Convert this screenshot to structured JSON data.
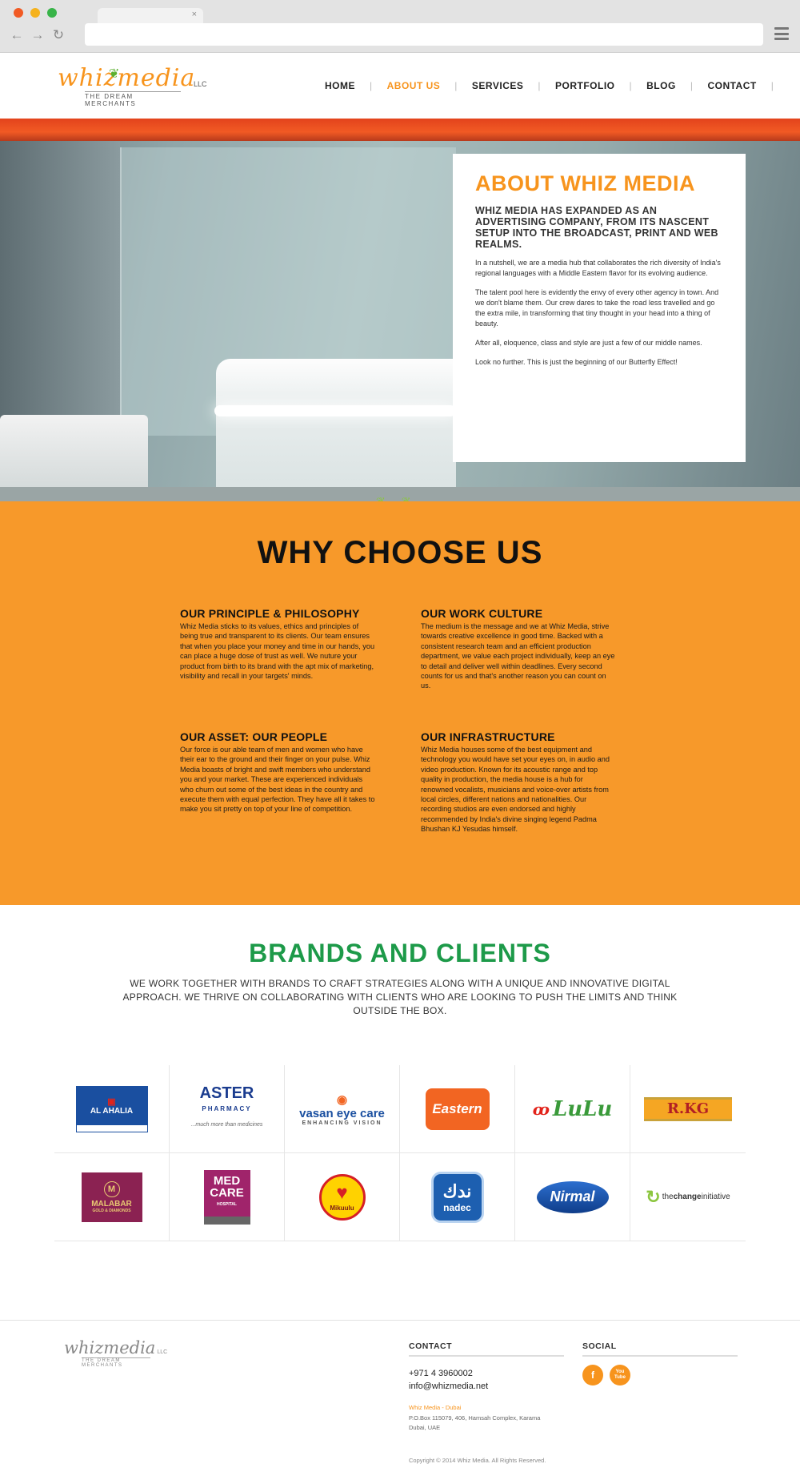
{
  "browser": {
    "tab_close": "×",
    "back_icon": "←",
    "forward_icon": "→",
    "reload_icon": "↻"
  },
  "header": {
    "logo_text": "whizmedia",
    "logo_llc": "LLC",
    "logo_tagline": "THE DREAM MERCHANTS",
    "nav": [
      {
        "label": "HOME"
      },
      {
        "label": "ABOUT US",
        "active": true
      },
      {
        "label": "SERVICES"
      },
      {
        "label": "PORTFOLIO"
      },
      {
        "label": "BLOG"
      },
      {
        "label": "CONTACT"
      }
    ]
  },
  "about": {
    "title": "ABOUT WHIZ MEDIA",
    "subtitle": "WHIZ MEDIA HAS EXPANDED AS AN ADVERTISING COMPANY, FROM ITS NASCENT SETUP INTO THE BROADCAST, PRINT AND WEB REALMS.",
    "paragraphs": [
      "In a nutshell, we are a media hub that collaborates the rich diversity of India's regional languages with a Middle Eastern flavor for its evolving audience.",
      "The talent pool here is evidently the envy of every other agency in town. And we don't blame them. Our crew dares to take the road less travelled and go the extra mile, in transforming that tiny thought in your head into a thing of beauty.",
      "After all, eloquence, class and style are just a few of our middle names.",
      "Look no further. This is just the beginning of our Butterfly Effect!"
    ]
  },
  "why": {
    "title": "WHY CHOOSE US",
    "blocks": [
      {
        "title": "OUR PRINCIPLE & PHILOSOPHY",
        "text": "Whiz Media sticks to its values, ethics and principles of being true and transparent to its clients. Our team ensures that when you place your money and time in our hands, you can place a huge dose of trust as well. We nuture your product from birth to its brand with the apt mix of marketing, visibility and recall in your targets' minds."
      },
      {
        "title": "OUR WORK CULTURE",
        "text": "The medium is the message and we at Whiz Media, strive towards creative excellence in good time. Backed with a consistent research team and an efficient production department, we value each project individually, keep an eye to detail and deliver well within deadlines. Every second counts for us and that's another reason you can count on us."
      },
      {
        "title": "OUR ASSET: OUR PEOPLE",
        "text": "Our force is our able team of men and women who have their ear to the ground and their finger on your pulse. Whiz Media boasts of bright and swift members who understand you and your market. These are experienced individuals who churn out some of the best ideas in the country and execute them with equal perfection. They have all it takes to make you sit pretty on top of your line of competition."
      },
      {
        "title": "OUR INFRASTRUCTURE",
        "text": "Whiz Media houses some of the best equipment and technology you would have set your eyes on, in audio and video production. Known for its acoustic range and top quality in production, the media house is a hub for renowned vocalists, musicians and voice-over artists from local circles, different nations and nationalities. Our recording studios are even endorsed and highly recommended by India's divine singing legend Padma Bhushan KJ Yesudas himself."
      }
    ]
  },
  "brands": {
    "title": "BRANDS AND CLIENTS",
    "description": "WE WORK TOGETHER WITH BRANDS TO CRAFT STRATEGIES ALONG WITH A UNIQUE AND INNOVATIVE DIGITAL APPROACH. WE THRIVE ON COLLABORATING WITH CLIENTS WHO ARE LOOKING TO PUSH THE LIMITS AND THINK OUTSIDE THE BOX.",
    "logos": {
      "alahlia": "AL AHALIA",
      "aster": "ASTER",
      "aster_sub": "PHARMACY",
      "aster_tag": "...much more than medicines",
      "vasan": "vasan eye care",
      "vasan_sub": "ENHANCING VISION",
      "eastern": "Eastern",
      "lulu": "LuLu",
      "rkg": "R.KG",
      "malabar": "MALABAR",
      "malabar_sub": "GOLD & DIAMONDS",
      "medcare": "MED CARE",
      "medcare_sub": "HOSPITAL",
      "mikuulu": "Mikuulu",
      "nadec": "nadec",
      "nirmal": "Nirmal",
      "change_pre": "the",
      "change_bold": "change",
      "change_post": "initiative"
    }
  },
  "footer": {
    "logo_text": "whizmedia",
    "logo_llc": "LLC",
    "logo_tagline": "THE DREAM MERCHANTS",
    "contact_title": "CONTACT",
    "phone": "+971 4 3960002",
    "email": "info@whizmedia.net",
    "office_name": "Whiz Media - Dubai",
    "address_1": "P.O.Box 115079, 406, Hamsah Complex, Karama",
    "address_2": "Dubai, UAE",
    "social_title": "SOCIAL",
    "facebook": "f",
    "youtube": "You Tube",
    "copyright": "Copyright © 2014 Whiz Media. All Rights Reserved."
  },
  "colors": {
    "accent": "#f7941d",
    "why_bg": "#f7992a",
    "brands_title": "#1d9a49"
  }
}
